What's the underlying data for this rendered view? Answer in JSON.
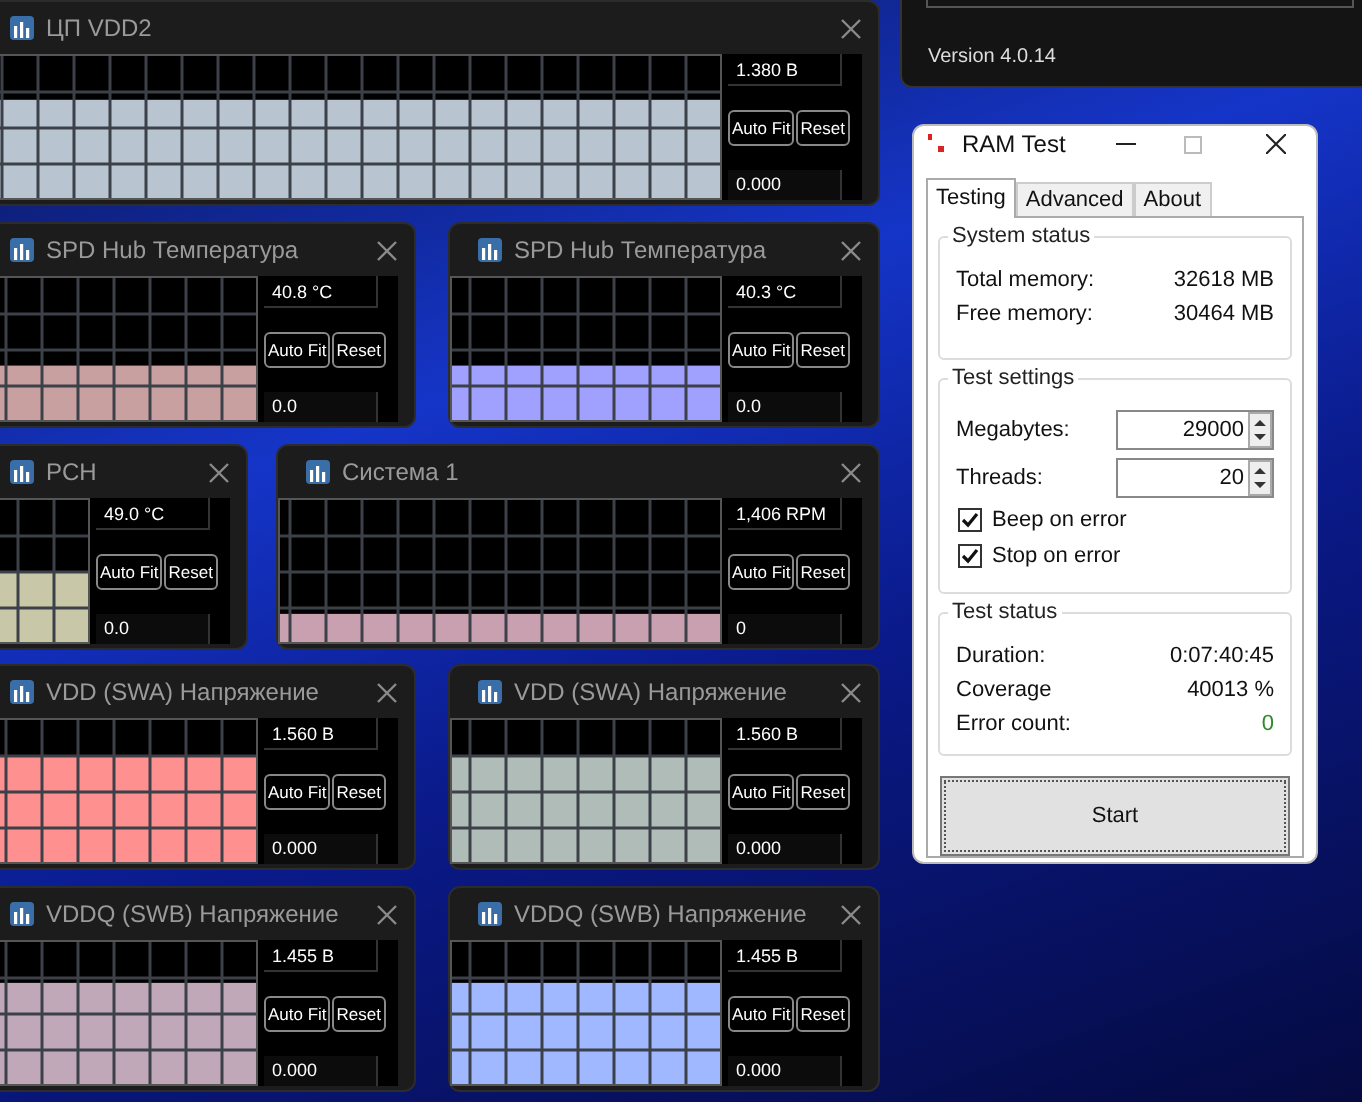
{
  "version_window": {
    "version": "Version 4.0.14"
  },
  "monitors": [
    {
      "title": "ЦП VDD2",
      "value": "1.380 В",
      "auto_fit": "Auto Fit",
      "reset": "Reset",
      "min": "0.000",
      "color": "#b8c4d0"
    },
    {
      "title": "SPD Hub Температура",
      "value": "40.8 °C",
      "auto_fit": "Auto Fit",
      "reset": "Reset",
      "min": "0.0",
      "color": "#c8a0a0"
    },
    {
      "title": "SPD Hub Температура",
      "value": "40.3 °C",
      "auto_fit": "Auto Fit",
      "reset": "Reset",
      "min": "0.0",
      "color": "#a0a0ff"
    },
    {
      "title": "PCH",
      "value": "49.0 °C",
      "auto_fit": "Auto Fit",
      "reset": "Reset",
      "min": "0.0",
      "color": "#c8c8a8"
    },
    {
      "title": "Система 1",
      "value": "1,406 RPM",
      "auto_fit": "Auto Fit",
      "reset": "Reset",
      "min": "0",
      "color": "#c8a0b0"
    },
    {
      "title": "VDD (SWA) Напряжение",
      "value": "1.560 В",
      "auto_fit": "Auto Fit",
      "reset": "Reset",
      "min": "0.000",
      "color": "#ff9090"
    },
    {
      "title": "VDD (SWA) Напряжение",
      "value": "1.560 В",
      "auto_fit": "Auto Fit",
      "reset": "Reset",
      "min": "0.000",
      "color": "#b0bcb8"
    },
    {
      "title": "VDDQ (SWB) Напряжение",
      "value": "1.455 В",
      "auto_fit": "Auto Fit",
      "reset": "Reset",
      "min": "0.000",
      "color": "#c0a8b8"
    },
    {
      "title": "VDDQ (SWB) Напряжение",
      "value": "1.455 В",
      "auto_fit": "Auto Fit",
      "reset": "Reset",
      "min": "0.000",
      "color": "#a0b8ff"
    }
  ],
  "ram_test": {
    "title": "RAM Test",
    "tabs": [
      {
        "label": "Testing",
        "selected": true
      },
      {
        "label": "Advanced",
        "selected": false
      },
      {
        "label": "About",
        "selected": false
      }
    ],
    "system_status": {
      "title": "System status",
      "rows": [
        {
          "label": "Total memory:",
          "value": "32618 MB"
        },
        {
          "label": "Free memory:",
          "value": "30464 MB"
        }
      ]
    },
    "test_settings": {
      "title": "Test settings",
      "fields": [
        {
          "label": "Megabytes:",
          "value": "29000"
        },
        {
          "label": "Threads:",
          "value": "20"
        }
      ],
      "checkboxes": [
        {
          "label": "Beep on error",
          "checked": true
        },
        {
          "label": "Stop on error",
          "checked": true
        }
      ]
    },
    "test_status": {
      "title": "Test status",
      "rows": [
        {
          "label": "Duration:",
          "value": "0:07:40:45"
        },
        {
          "label": "Coverage",
          "value": "40013 %"
        },
        {
          "label": "Error count:",
          "value": "0",
          "color": "#2e8b2e"
        }
      ]
    },
    "start_button": "Start"
  }
}
